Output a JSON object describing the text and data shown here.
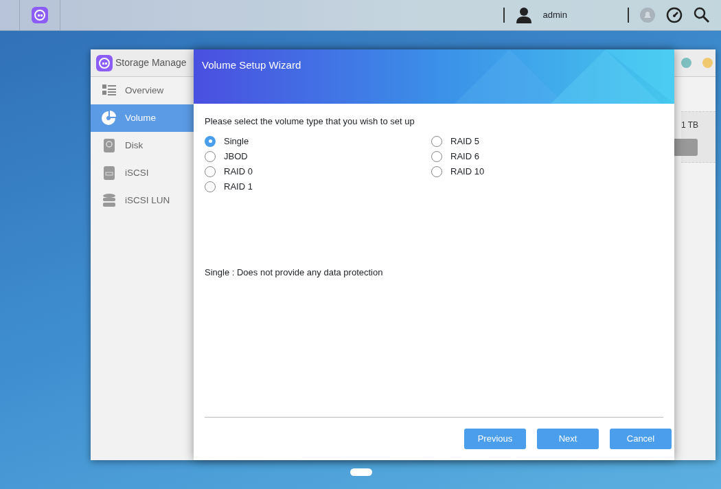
{
  "top_bar": {
    "user": "admin"
  },
  "window": {
    "title": "Storage Manage",
    "summary": "1 TB"
  },
  "sidebar": {
    "items": [
      {
        "label": "Overview",
        "kind": "overview",
        "selected": false
      },
      {
        "label": "Volume",
        "kind": "volume",
        "selected": true
      },
      {
        "label": "Disk",
        "kind": "disk",
        "selected": false
      },
      {
        "label": "iSCSI",
        "kind": "iscsi",
        "selected": false
      },
      {
        "label": "iSCSI LUN",
        "kind": "lun",
        "selected": false
      }
    ]
  },
  "dialog": {
    "title": "Volume Setup Wizard",
    "prompt": "Please select the volume type that you wish to set up",
    "options": [
      {
        "label": "Single",
        "selected": true
      },
      {
        "label": "JBOD",
        "selected": false
      },
      {
        "label": "RAID 0",
        "selected": false
      },
      {
        "label": "RAID 1",
        "selected": false
      },
      {
        "label": "RAID 5",
        "selected": false
      },
      {
        "label": "RAID 6",
        "selected": false
      },
      {
        "label": "RAID 10",
        "selected": false
      }
    ],
    "description": "Single : Does not provide any data protection",
    "buttons": [
      "Previous",
      "Next",
      "Cancel"
    ]
  }
}
